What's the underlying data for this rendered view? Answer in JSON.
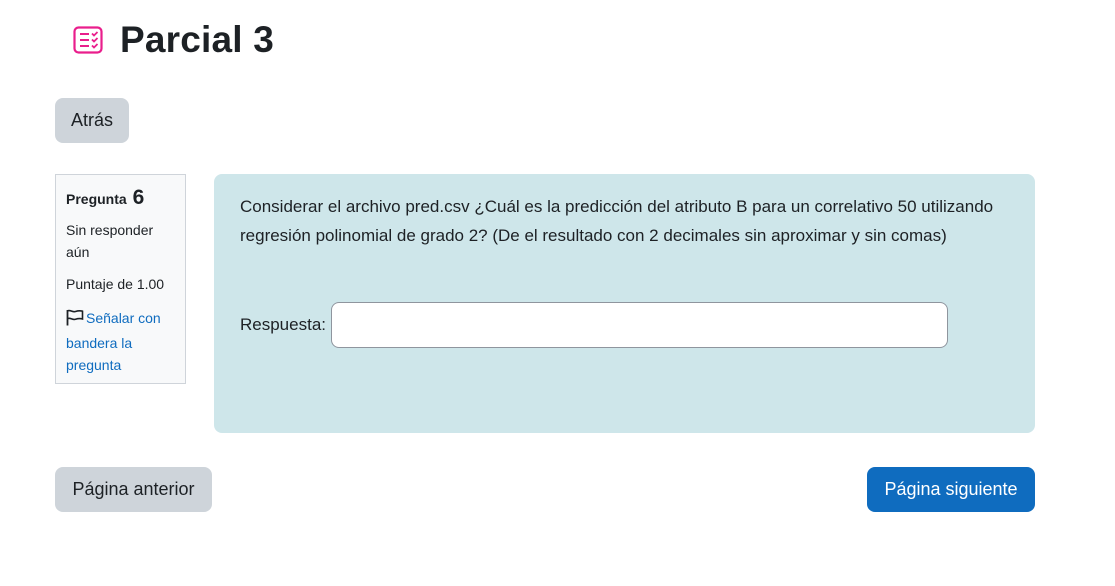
{
  "header": {
    "icon": "quiz-icon",
    "title": "Parcial 3",
    "accent_color": "#e91e8c"
  },
  "navigation": {
    "back_label": "Atrás",
    "prev_label": "Página anterior",
    "next_label": "Página siguiente"
  },
  "question_info": {
    "heading_label": "Pregunta",
    "number": "6",
    "state": "Sin responder aún",
    "grade": "Puntaje de 1.00",
    "flag_icon": "flag-icon",
    "flag_label": "Señalar con bandera la pregunta"
  },
  "question": {
    "text": "Considerar el archivo pred.csv ¿Cuál es la predicción del atributo B para un correlativo 50 utilizando regresión polinomial de grado 2? (De el resultado con 2 decimales sin aproximar y sin comas)",
    "answer_label": "Respuesta:",
    "answer_value": ""
  },
  "colors": {
    "primary": "#0f6cbf",
    "secondary": "#ced4da",
    "question_bg": "#cee6ea"
  }
}
